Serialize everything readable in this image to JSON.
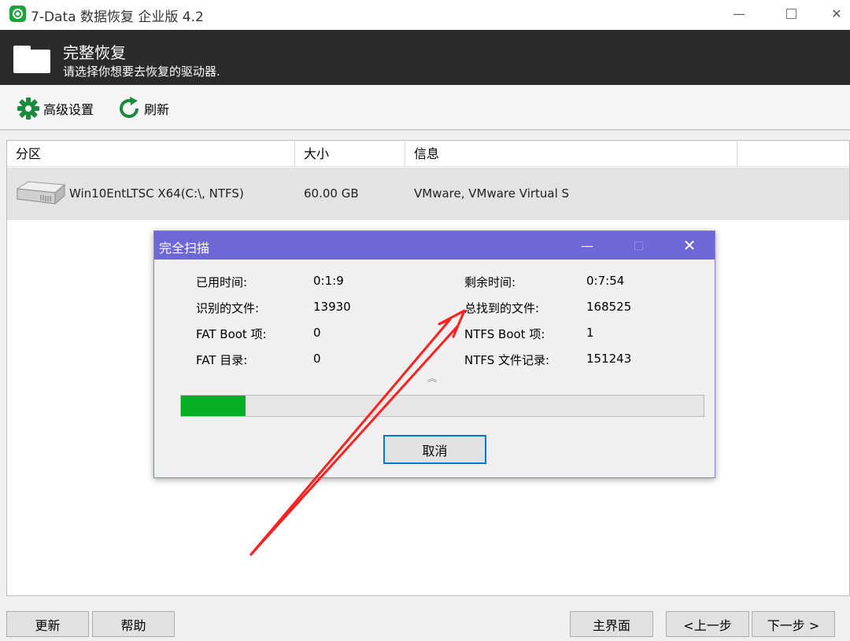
{
  "window": {
    "title": "7-Data 数据恢复 企业版 4.2",
    "minimize": "—",
    "close": "✕"
  },
  "header": {
    "title": "完整恢复",
    "subtitle": "请选择你想要去恢复的驱动器."
  },
  "toolbar": {
    "advanced_settings": "高级设置",
    "refresh": "刷新"
  },
  "table": {
    "columns": [
      "分区",
      "大小",
      "信息"
    ],
    "rows": [
      {
        "partition": "Win10EntLTSC X64(C:\\, NTFS)",
        "size": "60.00 GB",
        "info": "VMware,  VMware Virtual S"
      }
    ]
  },
  "dialog": {
    "title": "完全扫描",
    "minimize": "—",
    "close": "✕",
    "stats": {
      "elapsed_label": "已用时间:",
      "elapsed_value": "0:1:9",
      "remaining_label": "剩余时间:",
      "remaining_value": "0:7:54",
      "identified_label": "识别的文件:",
      "identified_value": "13930",
      "total_found_label": "总找到的文件:",
      "total_found_value": "168525",
      "fat_boot_label": "FAT Boot 项:",
      "fat_boot_value": "0",
      "ntfs_boot_label": "NTFS Boot 项:",
      "ntfs_boot_value": "1",
      "fat_dir_label": "FAT 目录:",
      "fat_dir_value": "0",
      "ntfs_records_label": "NTFS 文件记录:",
      "ntfs_records_value": "151243"
    },
    "progress_fraction": 0.124,
    "cancel": "取消"
  },
  "footer": {
    "update": "更新",
    "help": "帮助",
    "home": "主界面",
    "prev": "<上一步",
    "next": "下一步 >"
  },
  "colors": {
    "header_bg": "#2b2b2b",
    "dialog_title_bg": "#6e67d6",
    "progress_fill": "#06b025",
    "annotation_arrow": "#ff2020",
    "app_icon": "#1aa53a"
  }
}
